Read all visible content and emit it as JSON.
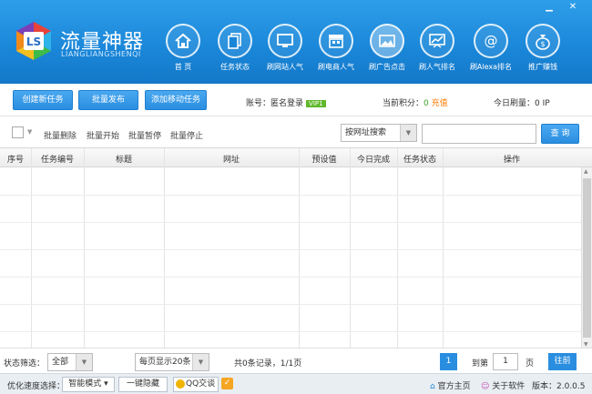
{
  "app": {
    "title": "流量神器",
    "subtitle": "LIANGLIANGSHENQI",
    "logo_text": "LS"
  },
  "window_controls": {
    "minimize": "▁",
    "close": "✕"
  },
  "nav": [
    {
      "label": "首  页",
      "icon": "home-icon"
    },
    {
      "label": "任务状态",
      "icon": "document-icon"
    },
    {
      "label": "刷网站人气",
      "icon": "monitor-icon"
    },
    {
      "label": "刷电商人气",
      "icon": "shop-icon"
    },
    {
      "label": "刷广告点击",
      "icon": "image-icon"
    },
    {
      "label": "刷人气排名",
      "icon": "chart-icon"
    },
    {
      "label": "刷Alexa排名",
      "icon": "at-icon"
    },
    {
      "label": "推广赚钱",
      "icon": "money-bag-icon"
    }
  ],
  "toolbar": {
    "create_task": "创建新任务",
    "batch_publish": "批量发布",
    "add_mobile_task": "添加移动任务",
    "account_label": "账号：",
    "account_value": "匿名登录",
    "vip_badge": "VIP1",
    "points_label": "当前积分：",
    "points_value": "0",
    "recharge": "充值",
    "today_label": "今日刷量：",
    "today_value": "0 IP"
  },
  "filter": {
    "batch_delete": "批量删除",
    "batch_start": "批量开始",
    "batch_pause": "批量暂停",
    "batch_stop": "批量停止",
    "search_mode": "按网址搜索",
    "search_placeholder": "",
    "query": "查 询"
  },
  "table": {
    "columns": [
      "序号",
      "任务编号",
      "标题",
      "网址",
      "预设值",
      "今日完成",
      "任务状态",
      "操作"
    ],
    "rows": []
  },
  "pager": {
    "status_filter_label": "状态筛选：",
    "status_filter_value": "全部",
    "per_page": "每页显示20条",
    "records": "共0条记录，1/1页",
    "current_page": "1",
    "goto_label": "到第",
    "goto_value": "1",
    "page_unit": "页",
    "goto_button": "往前"
  },
  "statusbar": {
    "speed_label": "优化速度选择：",
    "speed_mode": "智能模式",
    "hide_button": "一键隐藏",
    "qq": "QQ交谈",
    "homepage": "官方主页",
    "about": "关于软件",
    "version": "版本：2.0.0.5"
  },
  "colors": {
    "header": "#1a86d8",
    "accent": "#2a8ee0",
    "vip": "#5fb82a",
    "recharge": "#ff7a00"
  }
}
